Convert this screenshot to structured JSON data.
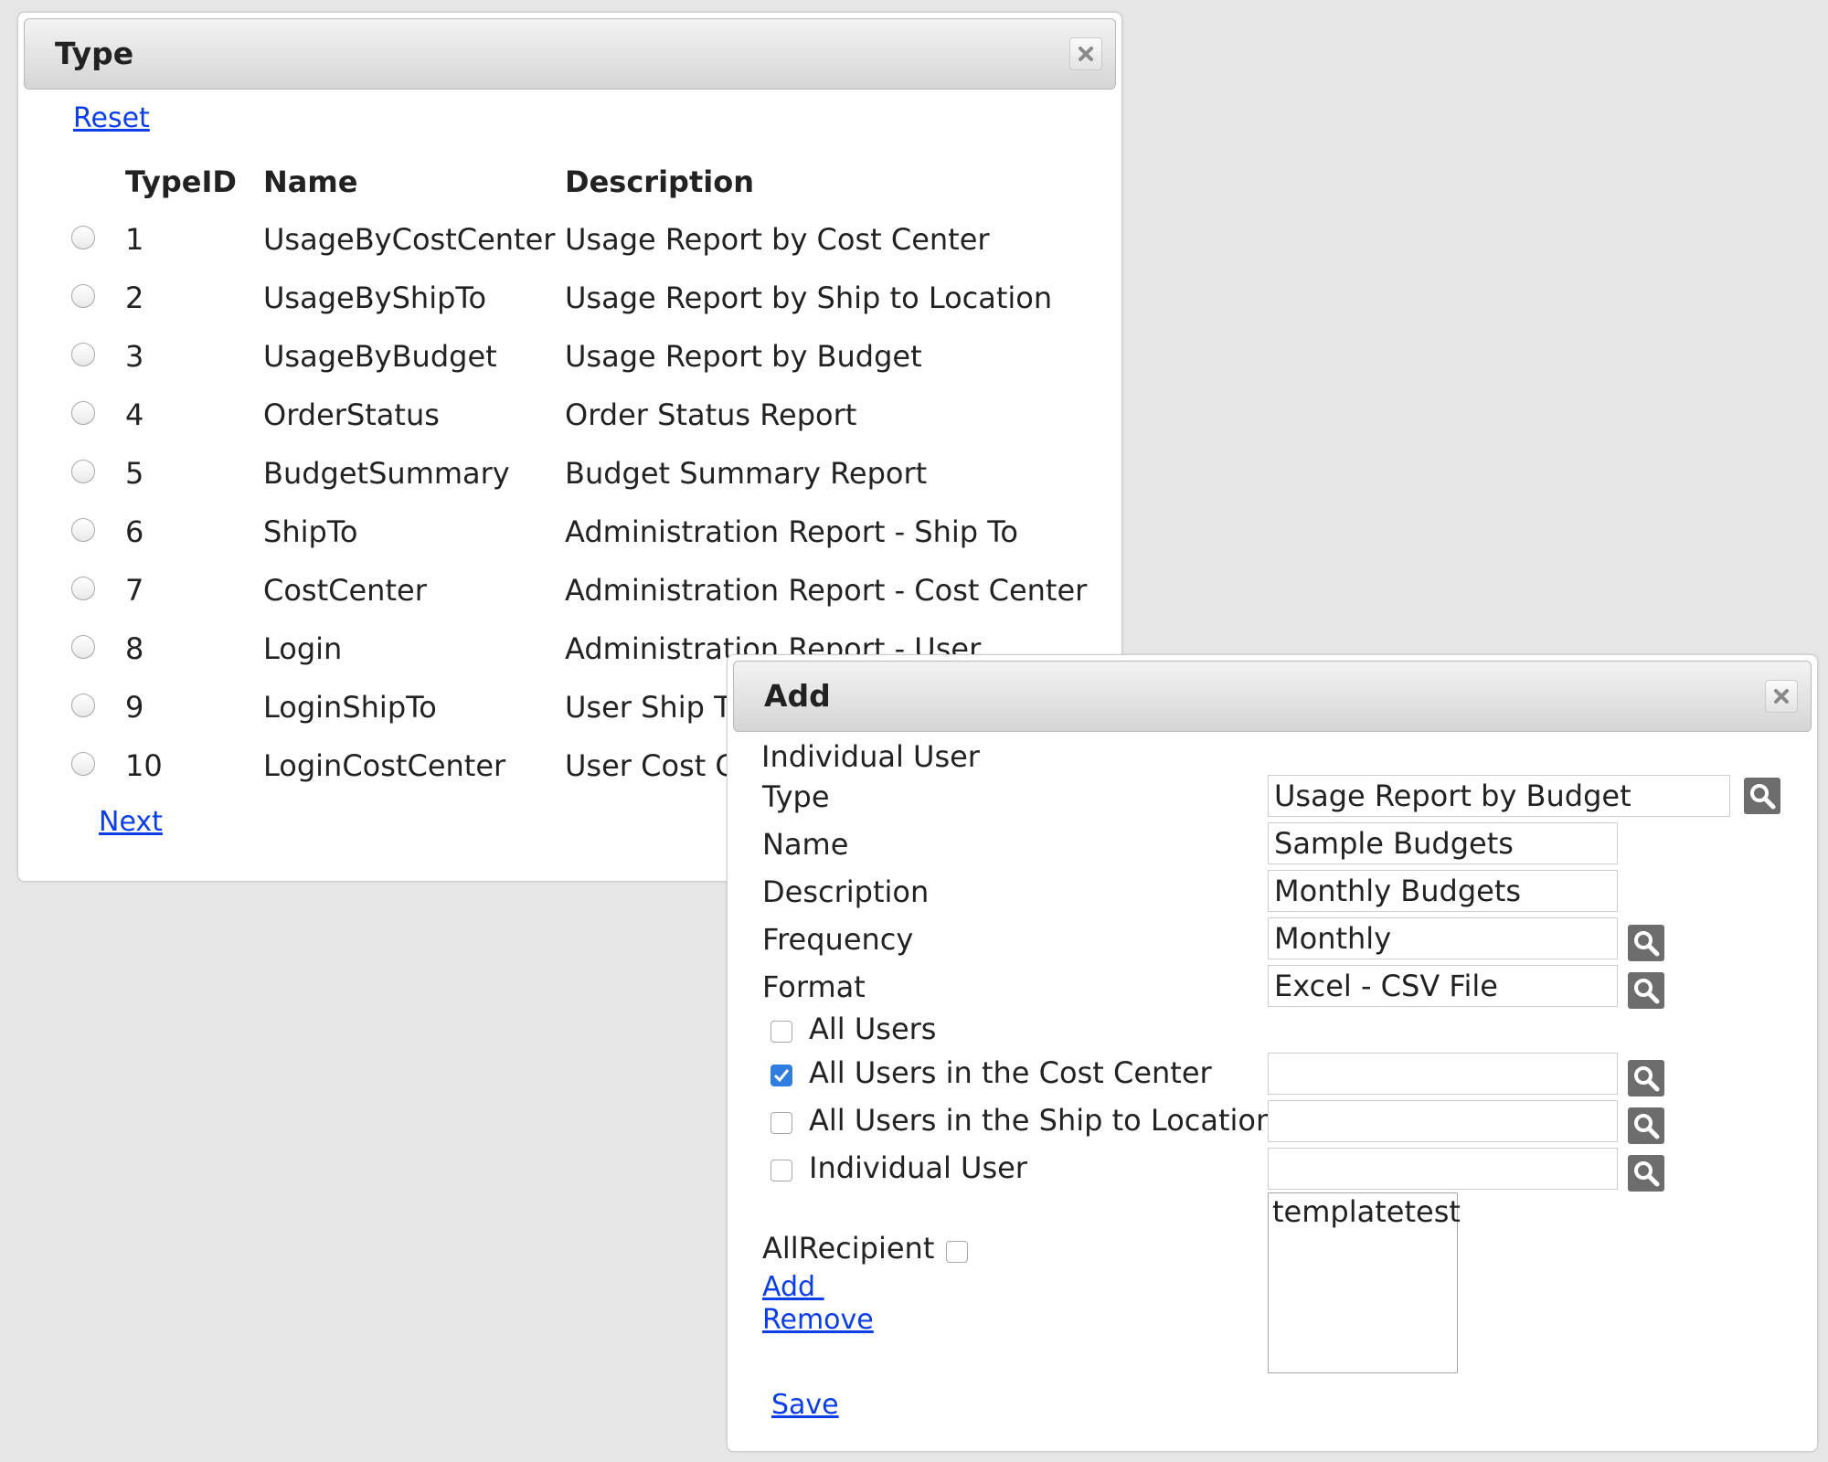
{
  "type_dialog": {
    "title": "Type",
    "reset_label": "Reset",
    "next_label": "Next",
    "columns": {
      "id": "TypeID",
      "name": "Name",
      "description": "Description"
    },
    "rows": [
      {
        "id": "1",
        "name": "UsageByCostCenter",
        "description": "Usage Report by Cost Center"
      },
      {
        "id": "2",
        "name": "UsageByShipTo",
        "description": "Usage Report by Ship to Location"
      },
      {
        "id": "3",
        "name": "UsageByBudget",
        "description": "Usage Report by Budget"
      },
      {
        "id": "4",
        "name": "OrderStatus",
        "description": "Order Status Report"
      },
      {
        "id": "5",
        "name": "BudgetSummary",
        "description": "Budget Summary Report"
      },
      {
        "id": "6",
        "name": "ShipTo",
        "description": "Administration Report - Ship To"
      },
      {
        "id": "7",
        "name": "CostCenter",
        "description": "Administration Report - Cost Center"
      },
      {
        "id": "8",
        "name": "Login",
        "description": "Administration Report - User"
      },
      {
        "id": "9",
        "name": "LoginShipTo",
        "description": "User Ship T"
      },
      {
        "id": "10",
        "name": "LoginCostCenter",
        "description": "User Cost C"
      }
    ]
  },
  "add_dialog": {
    "title": "Add",
    "heading": "Individual User",
    "fields": {
      "type": {
        "label": "Type",
        "value": "Usage Report by Budget"
      },
      "name": {
        "label": "Name",
        "value": "Sample Budgets"
      },
      "description": {
        "label": "Description",
        "value": "Monthly Budgets"
      },
      "frequency": {
        "label": "Frequency",
        "value": "Monthly"
      },
      "format": {
        "label": "Format",
        "value": "Excel - CSV File"
      }
    },
    "recipients": {
      "all_users": {
        "label": "All Users",
        "checked": false
      },
      "cost_center": {
        "label": "All Users in the Cost Center",
        "checked": true,
        "value": ""
      },
      "ship_to": {
        "label": "All Users in the Ship to Location",
        "checked": false,
        "value": ""
      },
      "individual": {
        "label": "Individual User",
        "checked": false,
        "value": ""
      }
    },
    "all_recipient_label": "AllRecipient",
    "add_label": "Add ",
    "remove_label": "Remove",
    "recipient_list": [
      "templatetest"
    ],
    "save_label": "Save"
  },
  "colors": {
    "link": "#0b3ee6",
    "checkbox_checked": "#2f7de1",
    "lookup_button": "#6d6d6d"
  },
  "icons": {
    "close": "close-x-icon",
    "lookup": "magnifier-icon"
  }
}
